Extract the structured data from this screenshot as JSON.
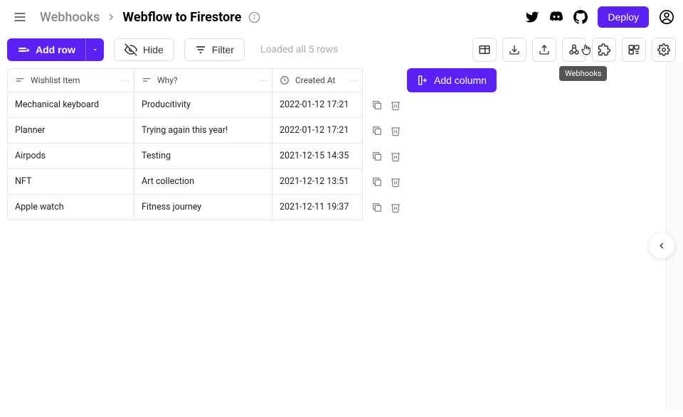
{
  "breadcrumb": {
    "parent": "Webhooks",
    "current": "Webflow to Firestore"
  },
  "header": {
    "deploy": "Deploy"
  },
  "toolbar": {
    "addrow": "Add row",
    "hide": "Hide",
    "filter": "Filter",
    "loaded": "Loaded all 5 rows",
    "tooltip": "Webhooks"
  },
  "columns": {
    "wishlist": "Wishlist Item",
    "why": "Why?",
    "created": "Created At",
    "addcol": "Add column"
  },
  "rows": [
    {
      "wishlist": "Mechanical keyboard",
      "why": "Producitivity",
      "created": "2022-01-12 17:21"
    },
    {
      "wishlist": "Planner",
      "why": "Trying again this year!",
      "created": "2022-01-12 17:21"
    },
    {
      "wishlist": "Airpods",
      "why": "Testing",
      "created": "2021-12-15 14:35"
    },
    {
      "wishlist": "NFT",
      "why": "Art collection",
      "created": "2021-12-12 13:51"
    },
    {
      "wishlist": "Apple watch",
      "why": "Fitness journey",
      "created": "2021-12-11 19:37"
    }
  ]
}
